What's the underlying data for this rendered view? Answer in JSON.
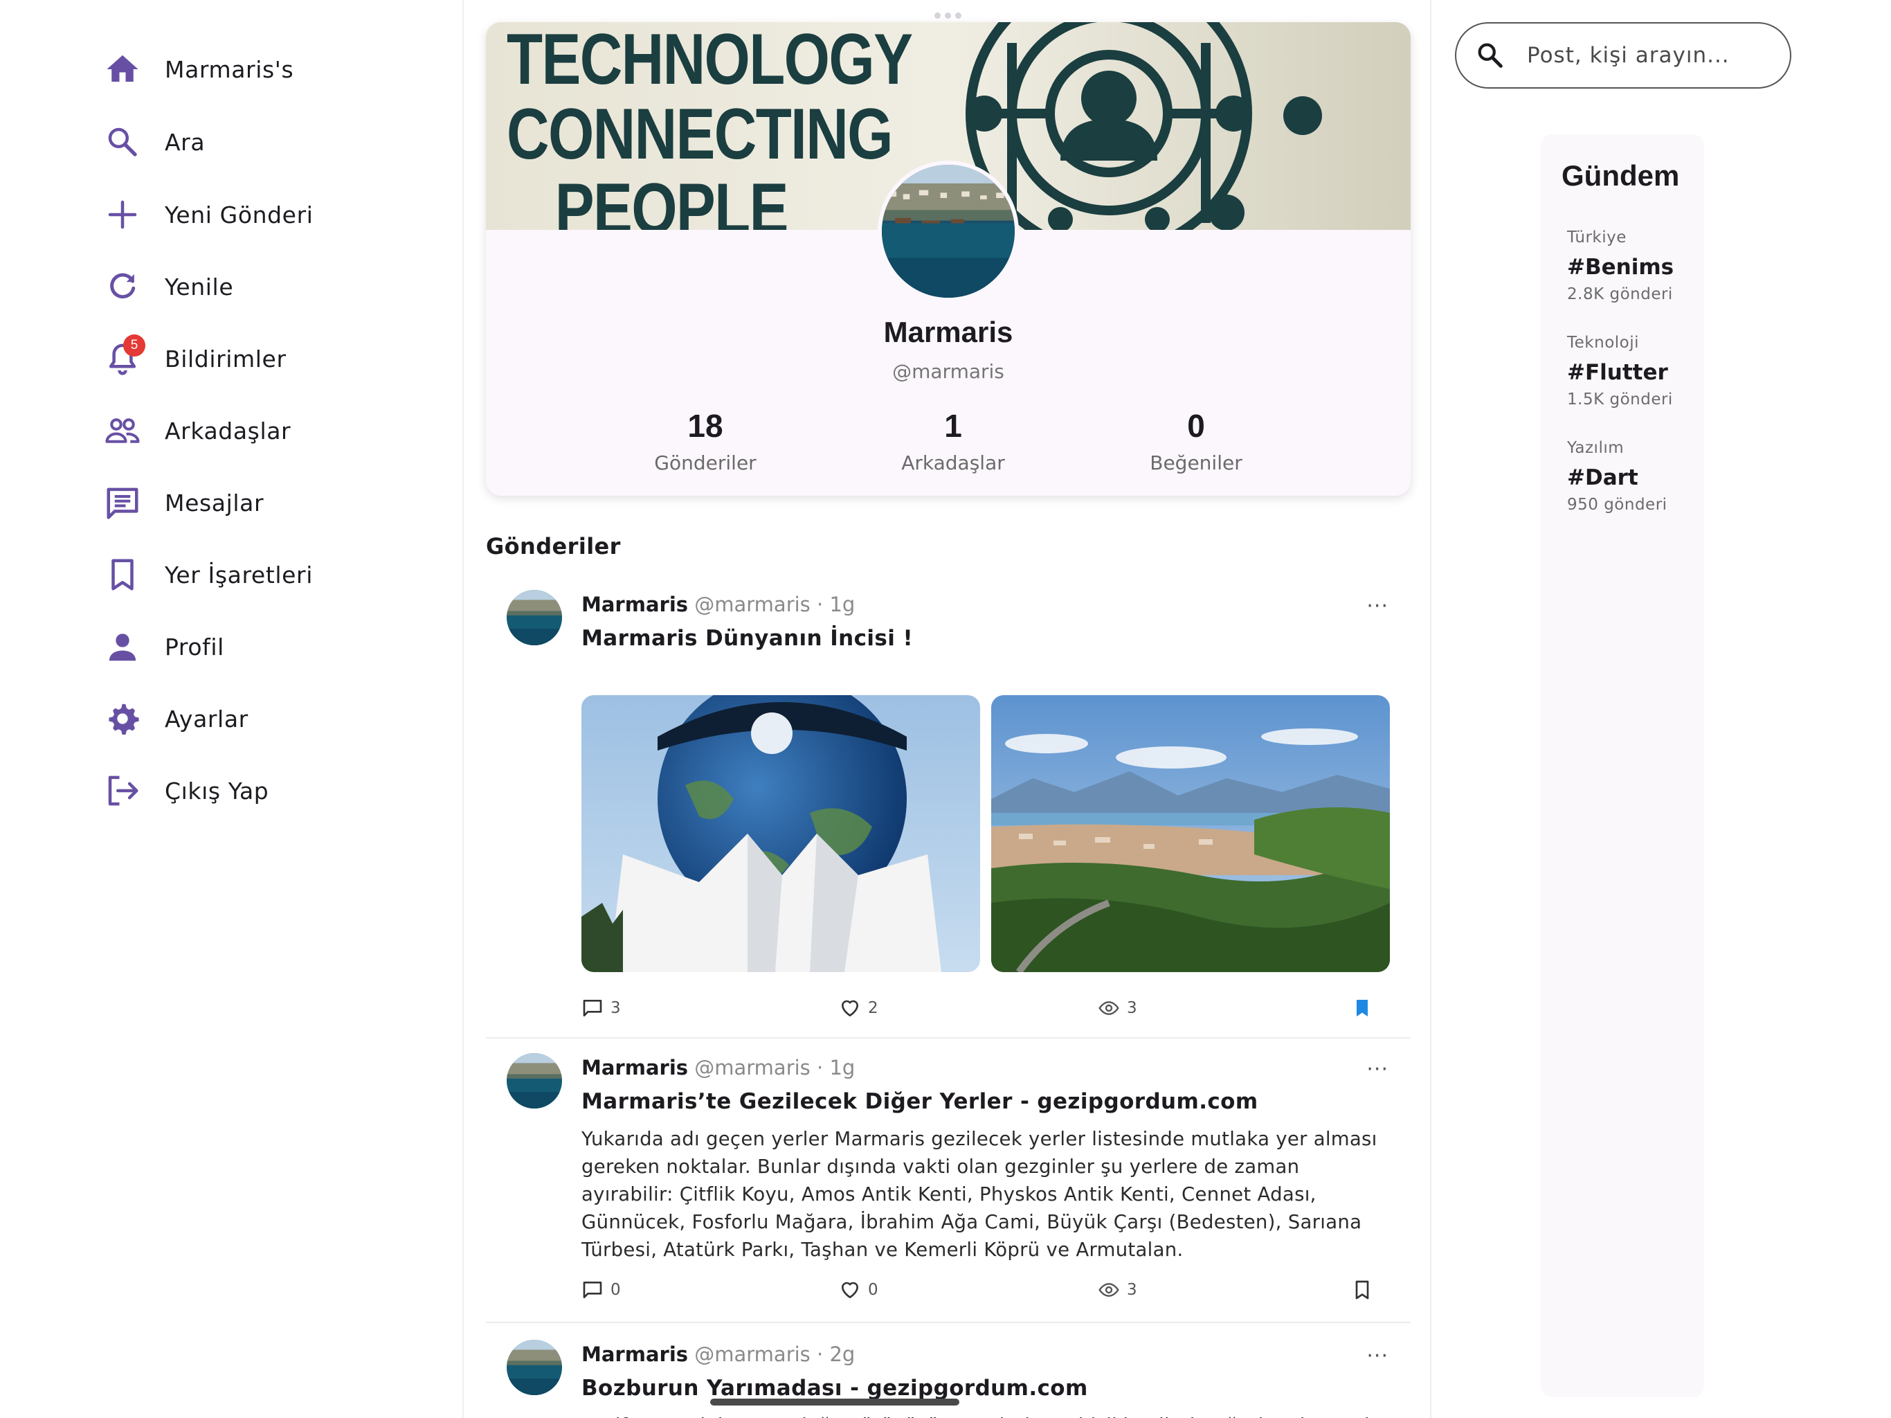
{
  "nav": {
    "items": [
      {
        "label": "Marmaris's",
        "icon": "home-icon"
      },
      {
        "label": "Ara",
        "icon": "search-icon"
      },
      {
        "label": "Yeni Gönderi",
        "icon": "plus-icon"
      },
      {
        "label": "Yenile",
        "icon": "refresh-icon"
      },
      {
        "label": "Bildirimler",
        "icon": "bell-icon",
        "badge": "5"
      },
      {
        "label": "Arkadaşlar",
        "icon": "people-icon"
      },
      {
        "label": "Mesajlar",
        "icon": "message-icon"
      },
      {
        "label": "Yer İşaretleri",
        "icon": "bookmark-icon"
      },
      {
        "label": "Profil",
        "icon": "person-icon"
      },
      {
        "label": "Ayarlar",
        "icon": "gear-icon"
      },
      {
        "label": "Çıkış Yap",
        "icon": "logout-icon"
      }
    ]
  },
  "profile": {
    "banner": {
      "line1": "TECHNOLOGY",
      "line2": "CONNECTING",
      "line3": "PEOPLE"
    },
    "name": "Marmaris",
    "handle": "@marmaris",
    "stats": [
      {
        "value": "18",
        "label": "Gönderiler"
      },
      {
        "value": "1",
        "label": "Arkadaşlar"
      },
      {
        "value": "0",
        "label": "Beğeniler"
      }
    ]
  },
  "posts_heading": "Gönderiler",
  "posts": [
    {
      "author": "Marmaris",
      "meta": "@marmaris · 1g",
      "menu": "···",
      "title": "Marmaris Dünyanın İncisi !",
      "body": "",
      "comments": "3",
      "likes": "2",
      "views": "3",
      "bookmarked": true
    },
    {
      "author": "Marmaris",
      "meta": "@marmaris · 1g",
      "menu": "···",
      "title": "Marmaris’te Gezilecek Diğer Yerler - gezipgordum.com",
      "body": "Yukarıda adı geçen yerler Marmaris gezilecek yerler listesinde mutlaka yer alması gereken noktalar. Bunlar dışında vakti olan gezginler şu yerlere de zaman ayırabilir: Çitflik Koyu, Amos Antik Kenti, Physkos Antik Kenti, Cennet Adası, Günnücek, Fosforlu Mağara, İbrahim Ağa Cami, Büyük Çarşı (Bedesten), Sarıana Türbesi, Atatürk Parkı, Taşhan ve Kemerli Köprü ve Armutalan.",
      "comments": "0",
      "likes": "0",
      "views": "3",
      "bookmarked": false
    },
    {
      "author": "Marmaris",
      "meta": "@marmaris · 2g",
      "menu": "···",
      "title": "Bozburun Yarımadası - gezipgordum.com",
      "body": "Keşif yapmak isteyen doğa yürüyüşü severlerin ve bisikletçilerin uğrak noktası olan"
    }
  ],
  "search": {
    "placeholder": "Post, kişi arayın..."
  },
  "trends": {
    "title": "Gündem",
    "items": [
      {
        "category": "Türkiye",
        "tag": "#Benims",
        "count": "2.8K gönderi"
      },
      {
        "category": "Teknoloji",
        "tag": "#Flutter",
        "count": "1.5K gönderi"
      },
      {
        "category": "Yazılım",
        "tag": "#Dart",
        "count": "950 gönderi"
      }
    ]
  },
  "colors": {
    "accent": "#6750a4",
    "badge": "#e53935",
    "bookmark_active": "#1e88e5",
    "card_bg": "#fcf7fd"
  }
}
